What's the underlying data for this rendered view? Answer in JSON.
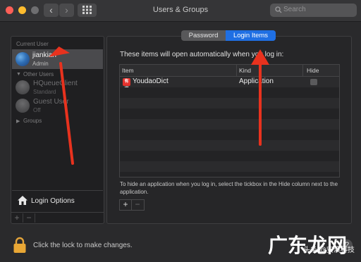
{
  "window": {
    "title": "Users & Groups"
  },
  "toolbar": {
    "back": "‹",
    "forward": "›"
  },
  "search": {
    "placeholder": "Search"
  },
  "sidebar": {
    "current_user_header": "Current User",
    "current_user": {
      "name": "jiankian",
      "role": "Admin"
    },
    "other_users_header": "Other Users",
    "other_users": [
      {
        "name": "HQueueClient",
        "role": "Standard"
      },
      {
        "name": "Guest User",
        "role": "Off"
      }
    ],
    "groups_label": "Groups",
    "login_options_label": "Login Options",
    "add": "+",
    "remove": "−"
  },
  "tabs": [
    {
      "label": "Password"
    },
    {
      "label": "Login Items"
    }
  ],
  "selected_tab": "Login Items",
  "login_items": {
    "description": "These items will open automatically when you log in:",
    "columns": {
      "item": "Item",
      "kind": "Kind",
      "hide": "Hide"
    },
    "rows": [
      {
        "icon_text": "有道",
        "item": "YoudaoDict",
        "kind": "Application",
        "hide": false
      }
    ],
    "hint": "To hide an application when you log in, select the tickbox in the Hide column next to the application.",
    "add": "+",
    "remove": "−"
  },
  "footer": {
    "lock_text": "Click the lock to make changes.",
    "help": "?"
  },
  "watermark": {
    "main": "广东龙网",
    "sub": "头条 @安浪科技"
  },
  "colors": {
    "accent": "#1f6fe3",
    "annotation_arrow": "#e8321e"
  }
}
